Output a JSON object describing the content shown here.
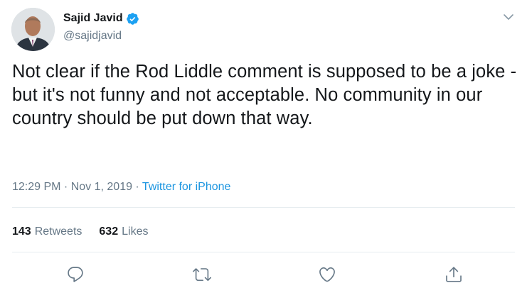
{
  "user": {
    "display_name": "Sajid Javid",
    "handle": "@sajidjavid",
    "verified": true
  },
  "tweet": {
    "text": "Not clear if the Rod Liddle comment is supposed to be a joke - but it's not funny and not acceptable. No community in our country should be put down that way.",
    "time": "12:29 PM",
    "date": "Nov 1, 2019",
    "separator": " · ",
    "source": "Twitter for iPhone"
  },
  "stats": {
    "retweets_count": "143",
    "retweets_label": "Retweets",
    "likes_count": "632",
    "likes_label": "Likes"
  },
  "icons": {
    "verified": "verified-badge-icon",
    "caret": "chevron-down-icon",
    "reply": "reply-icon",
    "retweet": "retweet-icon",
    "like": "heart-icon",
    "share": "share-icon"
  },
  "colors": {
    "text": "#14171a",
    "secondary": "#657786",
    "link": "#1b95e0",
    "verified": "#1da1f2",
    "divider": "#e6ecf0"
  }
}
